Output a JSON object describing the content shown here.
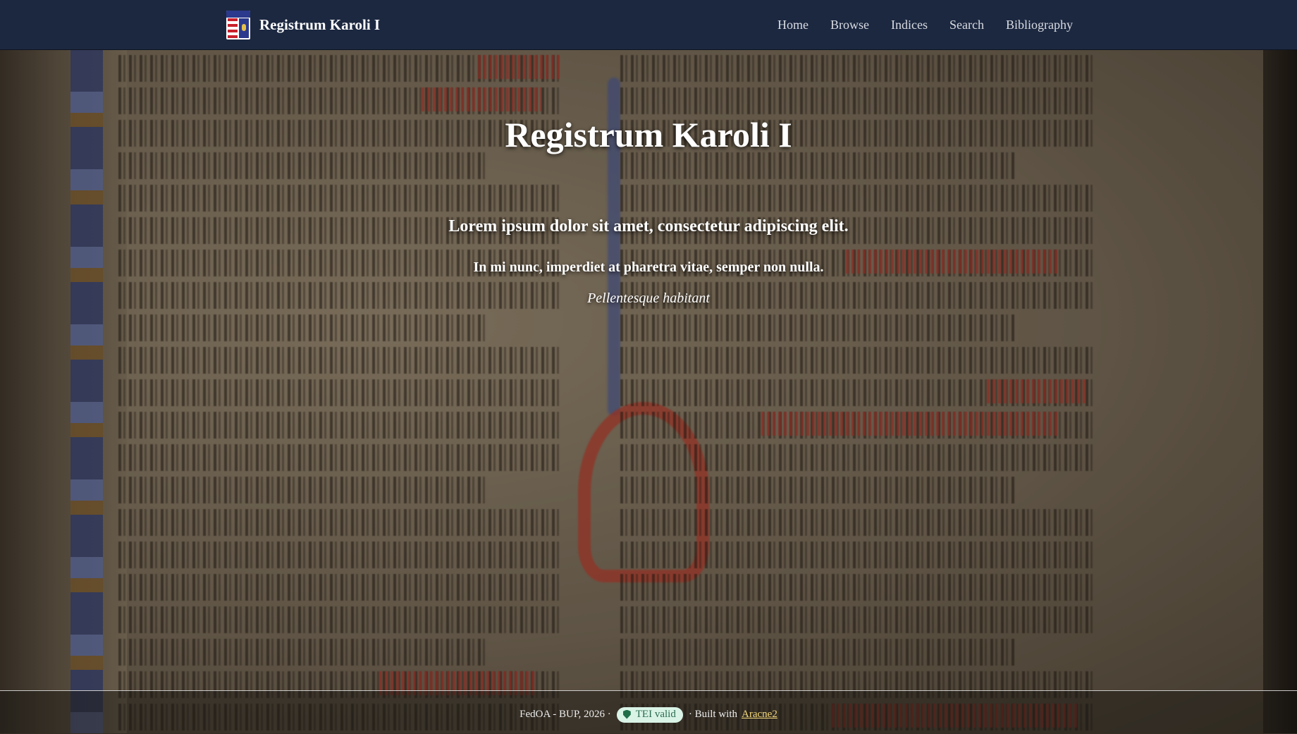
{
  "navbar": {
    "brand_title": "Registrum Karoli I",
    "brand_icon": "coat-of-arms-icon",
    "links": [
      {
        "label": "Home"
      },
      {
        "label": "Browse"
      },
      {
        "label": "Indices"
      },
      {
        "label": "Search"
      },
      {
        "label": "Bibliography"
      }
    ]
  },
  "hero": {
    "title": "Registrum Karoli I",
    "lead": "Lorem ipsum dolor sit amet, consectetur adipiscing elit.",
    "sub": "In mi nunc, imperdiet at pharetra vitae, semper non nulla.",
    "tagline": "Pellentesque habitant"
  },
  "footer": {
    "copyright": "FedOA - BUP, 2026 ·",
    "badge_label": "TEI valid",
    "badge_icon": "shield-check-icon",
    "built_with_text": "· Built with",
    "built_with_link": "Aracne2"
  },
  "colors": {
    "navbar_bg": "#1c2840",
    "badge_bg": "#d9f3e6",
    "badge_text": "#2a6b4f",
    "link_color": "#f3d77a"
  }
}
